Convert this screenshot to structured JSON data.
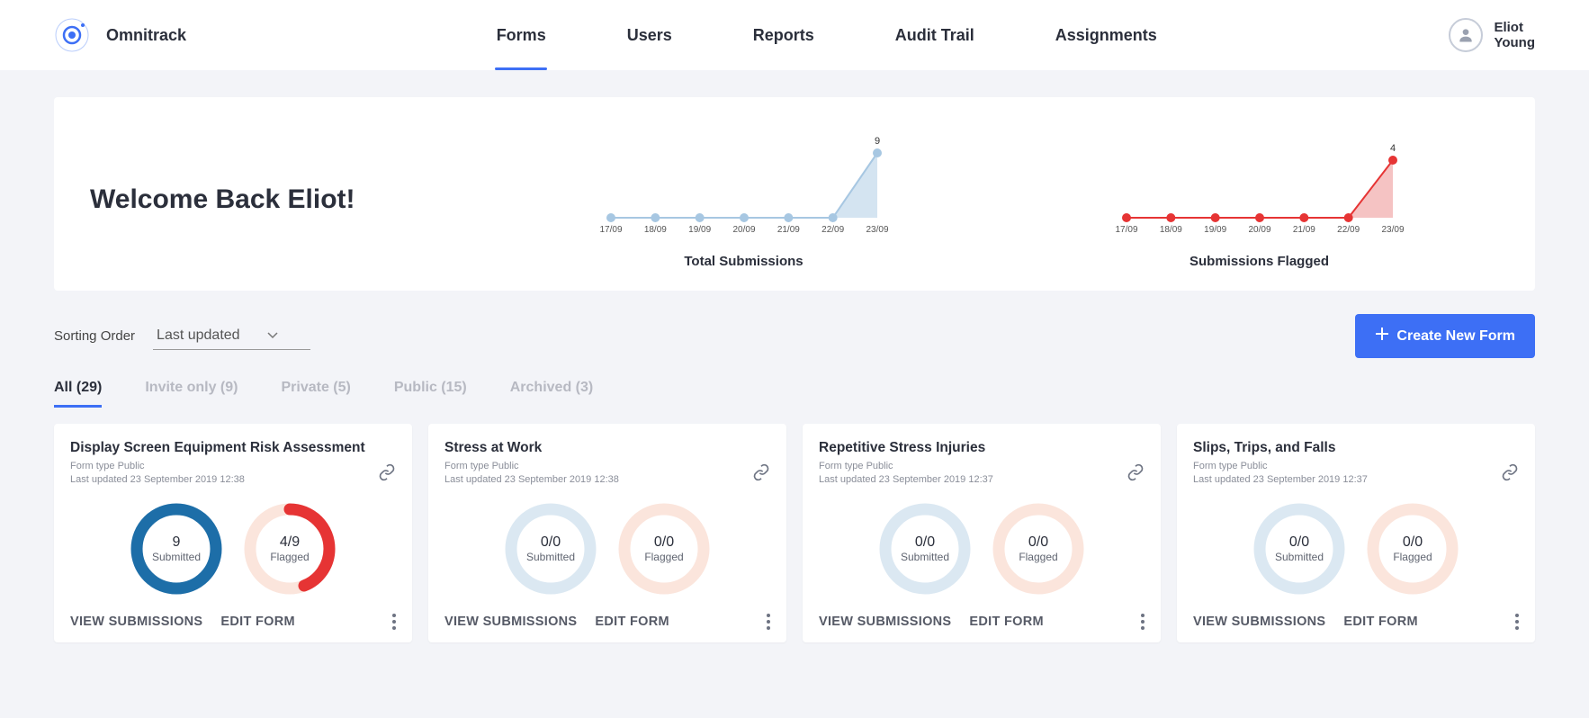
{
  "brand": "Omnitrack",
  "nav": {
    "items": [
      "Forms",
      "Users",
      "Reports",
      "Audit Trail",
      "Assignments"
    ],
    "active": 0
  },
  "user": {
    "name": "Eliot Young"
  },
  "welcome": "Welcome Back Eliot!",
  "chart_data": [
    {
      "type": "area",
      "title": "Total Submissions",
      "categories": [
        "17/09",
        "18/09",
        "19/09",
        "20/09",
        "21/09",
        "22/09",
        "23/09"
      ],
      "values": [
        0,
        0,
        0,
        0,
        0,
        0,
        9
      ],
      "ylim": [
        0,
        10
      ],
      "color": "#a7c7e2",
      "peak_label": "9"
    },
    {
      "type": "area",
      "title": "Submissions Flagged",
      "categories": [
        "17/09",
        "18/09",
        "19/09",
        "20/09",
        "21/09",
        "22/09",
        "23/09"
      ],
      "values": [
        0,
        0,
        0,
        0,
        0,
        0,
        4
      ],
      "ylim": [
        0,
        5
      ],
      "color": "#e63434",
      "peak_label": "4"
    }
  ],
  "sorting": {
    "label": "Sorting Order",
    "value": "Last updated"
  },
  "create_button": "Create New Form",
  "filters": [
    {
      "label": "All (29)",
      "active": true
    },
    {
      "label": "Invite only (9)",
      "active": false
    },
    {
      "label": "Private (5)",
      "active": false
    },
    {
      "label": "Public (15)",
      "active": false
    },
    {
      "label": "Archived (3)",
      "active": false
    }
  ],
  "card_labels": {
    "view": "VIEW SUBMISSIONS",
    "edit": "EDIT FORM",
    "submitted": "Submitted",
    "flagged": "Flagged"
  },
  "cards": [
    {
      "title": "Display Screen Equipment Risk Assessment",
      "form_type": "Form type Public",
      "updated": "Last updated 23 September 2019 12:38",
      "submitted_num": "9",
      "flagged_num": "4/9",
      "submitted_pct": 100,
      "flagged_pct": 44,
      "sub_color": "#1d6ea8",
      "flag_color": "#e63434"
    },
    {
      "title": "Stress at Work",
      "form_type": "Form type Public",
      "updated": "Last updated 23 September 2019 12:38",
      "submitted_num": "0/0",
      "flagged_num": "0/0",
      "submitted_pct": 0,
      "flagged_pct": 0,
      "sub_color": "#a7c7e2",
      "flag_color": "#f6c9b8"
    },
    {
      "title": "Repetitive Stress Injuries",
      "form_type": "Form type Public",
      "updated": "Last updated 23 September 2019 12:37",
      "submitted_num": "0/0",
      "flagged_num": "0/0",
      "submitted_pct": 0,
      "flagged_pct": 0,
      "sub_color": "#a7c7e2",
      "flag_color": "#f6c9b8"
    },
    {
      "title": "Slips, Trips, and Falls",
      "form_type": "Form type Public",
      "updated": "Last updated 23 September 2019 12:37",
      "submitted_num": "0/0",
      "flagged_num": "0/0",
      "submitted_pct": 0,
      "flagged_pct": 0,
      "sub_color": "#a7c7e2",
      "flag_color": "#f6c9b8"
    }
  ]
}
